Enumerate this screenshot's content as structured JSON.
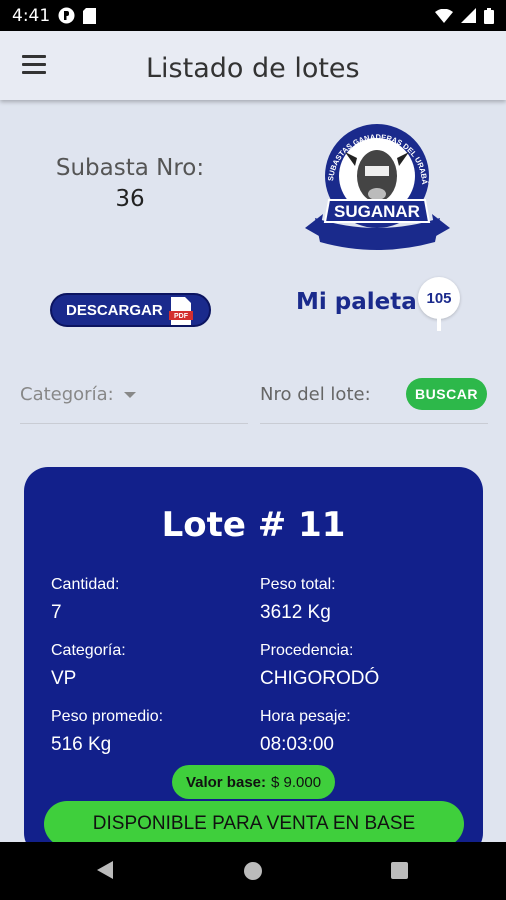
{
  "status_bar": {
    "time": "4:41"
  },
  "header": {
    "title": "Listado de lotes"
  },
  "auction": {
    "label": "Subasta Nro:",
    "number": "36"
  },
  "logo": {
    "name": "SUGANAR",
    "arc_text": "SUBASTAS GANADERAS DEL URABÁ GRANDE"
  },
  "actions": {
    "download_label": "DESCARGAR",
    "pdf_text": "PDF",
    "paddle_label": "Mi paleta",
    "paddle_number": "105"
  },
  "filters": {
    "category_label": "Categoría:",
    "lot_label": "Nro del lote:",
    "search_label": "BUSCAR"
  },
  "lot": {
    "title": "Lote # 11",
    "quantity_label": "Cantidad:",
    "quantity": "7",
    "total_weight_label": "Peso total:",
    "total_weight": "3612 Kg",
    "category_label": "Categoría:",
    "category": "VP",
    "origin_label": "Procedencia:",
    "origin": "CHIGORODÓ",
    "avg_weight_label": "Peso promedio:",
    "avg_weight": "516 Kg",
    "weigh_time_label": "Hora pesaje:",
    "weigh_time": "08:03:00",
    "base_price_label": "Valor base:",
    "base_price": "$ 9.000",
    "status": "DISPONIBLE PARA VENTA EN BASE"
  },
  "colors": {
    "primary": "#12208b",
    "accent": "#3fcf3c",
    "background": "#dfe4ef"
  }
}
